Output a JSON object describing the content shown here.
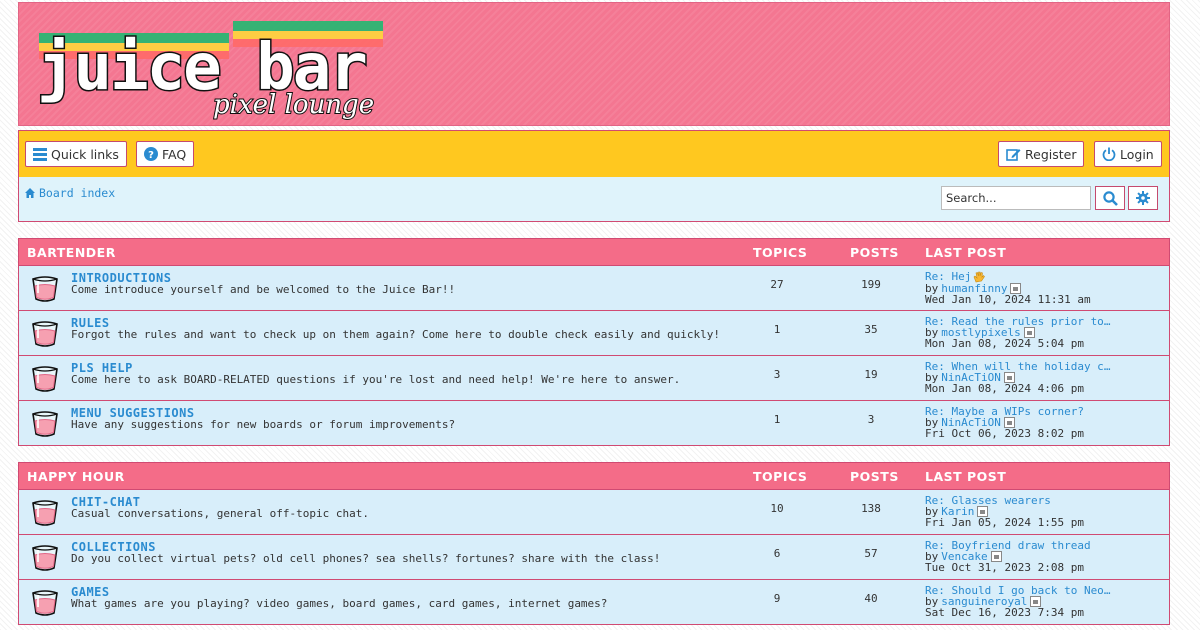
{
  "header": {
    "logo_main": "juice bar",
    "logo_sub": "pixel lounge",
    "colors": {
      "banner": "#f47691",
      "nav": "#ffc81f",
      "category_head": "#f46c88",
      "row": "#d8eefa",
      "link": "#2a8bd0",
      "border": "#d04a72"
    }
  },
  "nav": {
    "quick_links": "Quick links",
    "faq": "FAQ",
    "register": "Register",
    "login": "Login",
    "breadcrumb": "Board index",
    "search_placeholder": "Search...",
    "icons": [
      "bars-icon",
      "question-circle-icon",
      "edit-icon",
      "power-icon",
      "home-icon",
      "search-icon",
      "gear-icon"
    ]
  },
  "categories": [
    {
      "name": "BARTENDER",
      "col_topics": "TOPICS",
      "col_posts": "POSTS",
      "col_last": "LAST POST",
      "forums": [
        {
          "title": "INTRODUCTIONS",
          "desc": "Come introduce yourself and be welcomed to the Juice Bar!!",
          "topics": "27",
          "posts": "199",
          "last_title": "Re: Hej",
          "last_emoji": true,
          "last_by": "humanfinny",
          "last_date": "Wed Jan 10, 2024 11:31 am"
        },
        {
          "title": "RULES",
          "desc": "Forgot the rules and want to check up on them again? Come here to double check easily and quickly!",
          "topics": "1",
          "posts": "35",
          "last_title": "Re: Read the rules prior to p…",
          "last_emoji": false,
          "last_by": "mostlypixels",
          "last_date": "Mon Jan 08, 2024 5:04 pm"
        },
        {
          "title": "PLS HELP",
          "desc": "Come here to ask BOARD-RELATED questions if you're lost and need help! We're here to answer.",
          "topics": "3",
          "posts": "19",
          "last_title": "Re: When will the holiday con…",
          "last_emoji": false,
          "last_by": "NinAcTiON",
          "last_date": "Mon Jan 08, 2024 4:06 pm"
        },
        {
          "title": "MENU SUGGESTIONS",
          "desc": "Have any suggestions for new boards or forum improvements?",
          "topics": "1",
          "posts": "3",
          "last_title": "Re: Maybe a WIPs corner?",
          "last_emoji": false,
          "last_by": "NinAcTiON",
          "last_date": "Fri Oct 06, 2023 8:02 pm"
        }
      ]
    },
    {
      "name": "HAPPY HOUR",
      "col_topics": "TOPICS",
      "col_posts": "POSTS",
      "col_last": "LAST POST",
      "forums": [
        {
          "title": "CHIT-CHAT",
          "desc": "Casual conversations, general off-topic chat.",
          "topics": "10",
          "posts": "138",
          "last_title": "Re: Glasses wearers",
          "last_emoji": false,
          "last_by": "Karin",
          "last_date": "Fri Jan 05, 2024 1:55 pm"
        },
        {
          "title": "COLLECTIONS",
          "desc": "Do you collect virtual pets? old cell phones? sea shells? fortunes? share with the class!",
          "topics": "6",
          "posts": "57",
          "last_title": "Re: Boyfriend draw thread",
          "last_emoji": false,
          "last_by": "Vencake",
          "last_date": "Tue Oct 31, 2023 2:08 pm"
        },
        {
          "title": "GAMES",
          "desc": "What games are you playing? video games, board games, card games, internet games?",
          "topics": "9",
          "posts": "40",
          "last_title": "Re: Should I go back to Neope…",
          "last_emoji": false,
          "last_by": "sanguineroyal",
          "last_date": "Sat Dec 16, 2023 7:34 pm"
        }
      ]
    }
  ]
}
